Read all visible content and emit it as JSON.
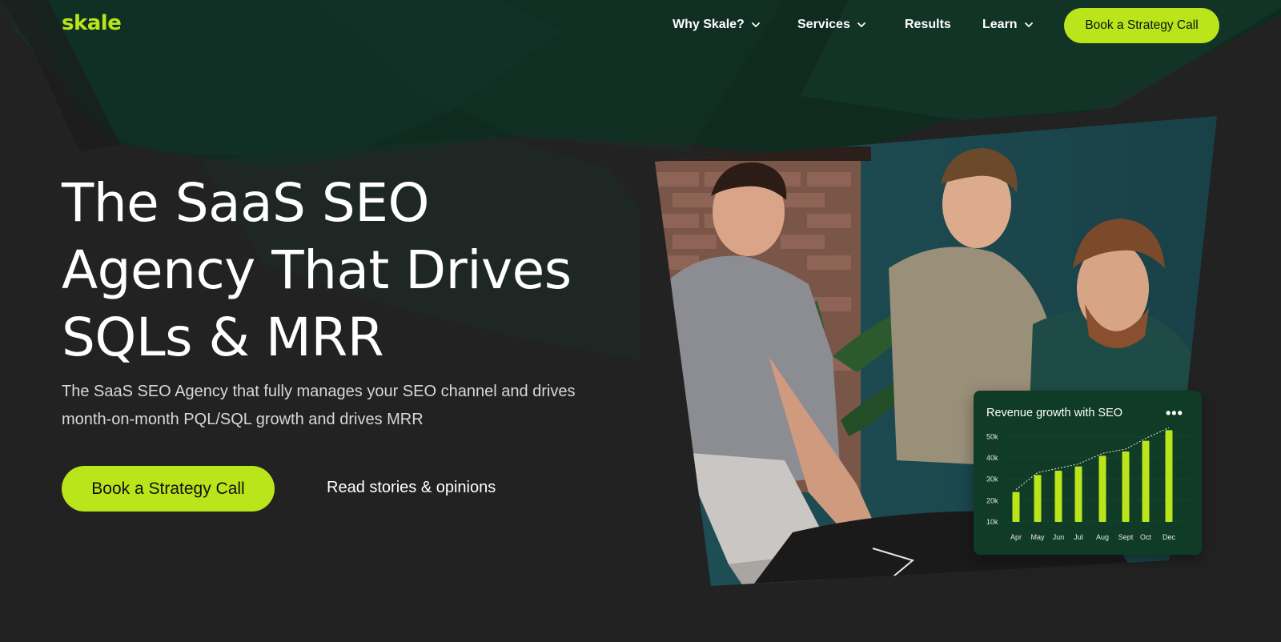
{
  "nav": {
    "logo": "skale",
    "items": [
      {
        "label": "Why Skale?",
        "has_dropdown": true
      },
      {
        "label": "Services",
        "has_dropdown": true
      },
      {
        "label": "Results",
        "has_dropdown": false
      },
      {
        "label": "Learn",
        "has_dropdown": true
      }
    ],
    "cta_label": "Book a Strategy Call"
  },
  "hero": {
    "title_lines": [
      "The SaaS SEO",
      "Agency That Drives",
      "SQLs & MRR"
    ],
    "subtitle_lines": [
      "The SaaS SEO Agency that fully manages your SEO channel and drives",
      "month-on-month PQL/SQL growth and drives MRR"
    ],
    "primary_cta": "Book a Strategy Call",
    "secondary_link": "Read stories & opinions"
  },
  "card": {
    "menu_icon": "more-dots-icon"
  },
  "colors": {
    "accent": "#b9e51a",
    "background": "#222222",
    "card_bg": "#0f3b27"
  },
  "chart_data": {
    "type": "bar",
    "title": "Revenue growth with SEO",
    "categories": [
      "Apr",
      "May",
      "Jun",
      "Jul",
      "Aug",
      "Sept",
      "Oct",
      "Dec"
    ],
    "values": [
      24,
      32,
      34,
      36,
      41,
      43,
      48,
      53
    ],
    "yticks": [
      "10k",
      "20k",
      "30k",
      "40k",
      "50k"
    ],
    "ylim": [
      10,
      52
    ],
    "trend_line": "dotted",
    "grid": true
  }
}
